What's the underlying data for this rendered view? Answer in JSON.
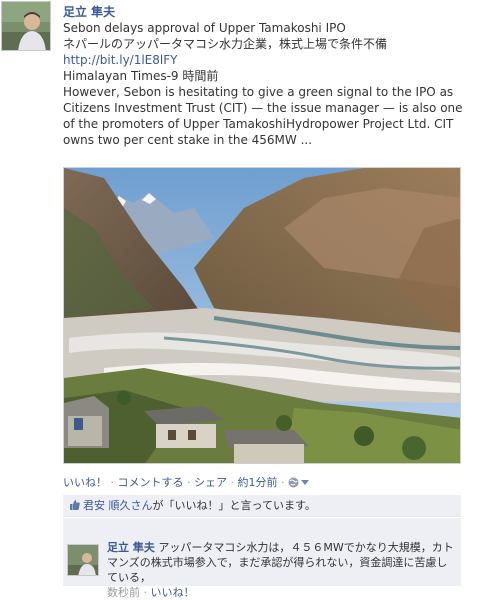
{
  "post": {
    "author": "足立 隼夫",
    "headline": "Sebon delays approval of Upper Tamakoshi IPO",
    "translation": "ネパールのアッパータマコシ水力企業，株式上場で条件不備",
    "link": "http://bit.ly/1lE8lFY",
    "source": "Himalayan Times-9 時間前",
    "snippet": "However, Sebon is hesitating to give a green signal to the IPO as Citizens Investment Trust (CIT) — the issue manager — is also one of the promoters of Upper TamakoshiHydropower Project Ltd. CIT owns two per cent stake in the 456MW ..."
  },
  "actions": {
    "like": "いいね！",
    "comment": "コメントする",
    "share": "シェア",
    "time": "約1分前",
    "sep": " · "
  },
  "likes": {
    "name": "君安 順久さん",
    "rest": "が「いいね！」と言っています。"
  },
  "comment": {
    "author": "足立 隼夫",
    "text": "アッパータマコシ水力は，４５６MWでかなり大規模，カトマンズの株式市場参入で，まだ承認が得られない，資金調達に苦慮している，",
    "time": "数秒前",
    "like": "いいね！"
  },
  "colors": {
    "link": "#3b5998",
    "ufi_bg": "#edeff4"
  }
}
